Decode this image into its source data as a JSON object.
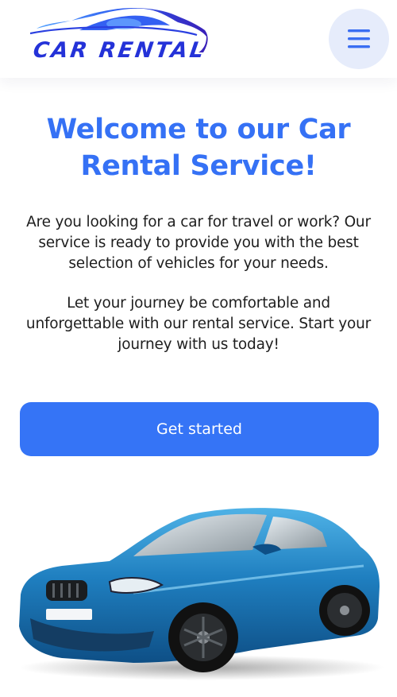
{
  "header": {
    "logo_text": "CAR RENTAL",
    "menu_icon": "hamburger-icon"
  },
  "hero": {
    "title": "Welcome to our Car Rental Service!",
    "paragraph_1": "Are you looking for a car for travel or work? Our service is ready to provide you with the best selection of vehicles for your needs.",
    "paragraph_2": "Let your journey be comfortable and unforgettable with our rental service. Start your journey with us today!",
    "cta_label": "Get started"
  },
  "colors": {
    "accent": "#3574f6",
    "title": "#3571f5",
    "logo": "#2432d8",
    "menu_bg": "#e6ecfb",
    "car_body": "#1f7fc0"
  }
}
